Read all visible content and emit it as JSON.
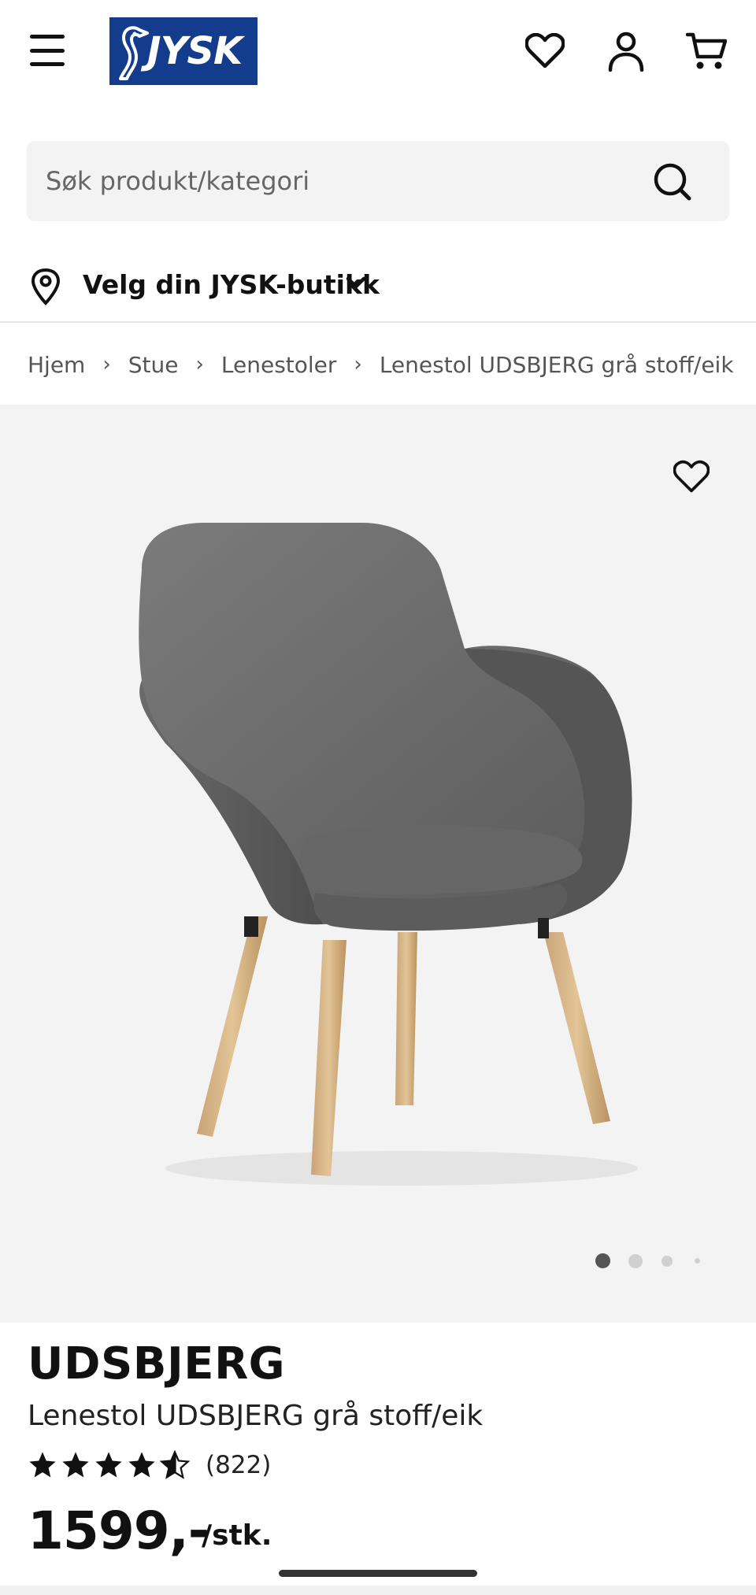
{
  "header": {
    "logo_text": "JYSK",
    "menu_icon": "hamburger-menu-icon",
    "wishlist_icon": "heart-icon",
    "account_icon": "user-icon",
    "cart_icon": "cart-icon",
    "brand_color": "#143c8c"
  },
  "search": {
    "placeholder": "Søk produkt/kategori",
    "value": "",
    "icon": "search-icon"
  },
  "store_selector": {
    "label": "Velg din JYSK-butikk",
    "pin_icon": "location-pin-icon",
    "chevron_icon": "chevron-down-icon"
  },
  "breadcrumb": {
    "items": [
      "Hjem",
      "Stue",
      "Lenestoler",
      "Lenestol UDSBJERG grå stoff/eik"
    ],
    "separator": "›"
  },
  "gallery": {
    "favorite_icon": "heart-icon",
    "image_count": 4,
    "active_index": 0,
    "background": "#f3f3f3"
  },
  "product": {
    "brand": "UDSBJERG",
    "name": "Lenestol UDSBJERG grå stoff/eik",
    "rating": 4.5,
    "rating_max": 5,
    "review_count": "(822)",
    "price": "1599,-",
    "unit": "/stk."
  }
}
